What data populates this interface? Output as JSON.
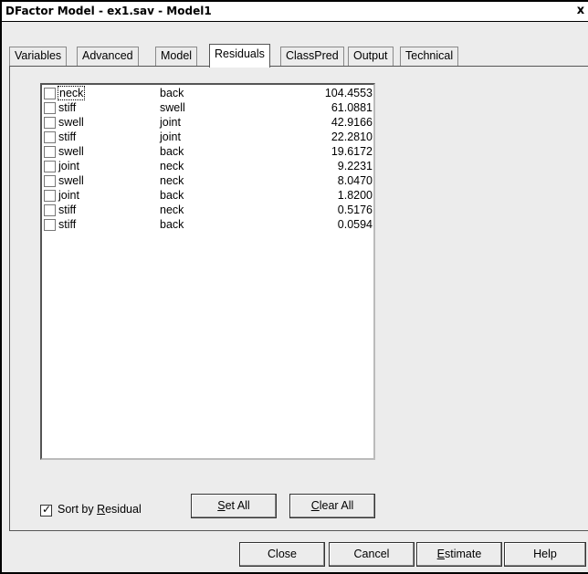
{
  "window": {
    "title": "DFactor Model - ex1.sav - Model1",
    "close_glyph": "x"
  },
  "tabs": [
    {
      "label": "Variables",
      "active": false
    },
    {
      "label": "Advanced",
      "active": false
    },
    {
      "label": "Model",
      "active": false
    },
    {
      "label": "Residuals",
      "active": true
    },
    {
      "label": "ClassPred",
      "active": false
    },
    {
      "label": "Output",
      "active": false
    },
    {
      "label": "Technical",
      "active": false
    }
  ],
  "residuals": [
    {
      "var1": "neck",
      "var2": "back",
      "value": "104.4553",
      "checked": false
    },
    {
      "var1": "stiff",
      "var2": "swell",
      "value": "61.0881",
      "checked": false
    },
    {
      "var1": "swell",
      "var2": "joint",
      "value": "42.9166",
      "checked": false
    },
    {
      "var1": "stiff",
      "var2": "joint",
      "value": "22.2810",
      "checked": false
    },
    {
      "var1": "swell",
      "var2": "back",
      "value": "19.6172",
      "checked": false
    },
    {
      "var1": "joint",
      "var2": "neck",
      "value": "9.2231",
      "checked": false
    },
    {
      "var1": "swell",
      "var2": "neck",
      "value": "8.0470",
      "checked": false
    },
    {
      "var1": "joint",
      "var2": "back",
      "value": "1.8200",
      "checked": false
    },
    {
      "var1": "stiff",
      "var2": "neck",
      "value": "0.5176",
      "checked": false
    },
    {
      "var1": "stiff",
      "var2": "back",
      "value": "0.0594",
      "checked": false
    }
  ],
  "sort_by_residual": {
    "label_pre": "Sort by ",
    "label_mnemonic": "R",
    "label_post": "esidual",
    "checked": true,
    "check_glyph": "✓"
  },
  "panel_buttons": {
    "set_all": {
      "mnemonic": "S",
      "rest": "et All"
    },
    "clear_all": {
      "mnemonic": "C",
      "rest": "lear All"
    }
  },
  "footer_buttons": {
    "close": {
      "label": "Close"
    },
    "cancel": {
      "label": "Cancel"
    },
    "estimate": {
      "mnemonic": "E",
      "rest": "stimate"
    },
    "help": {
      "label": "Help"
    }
  }
}
